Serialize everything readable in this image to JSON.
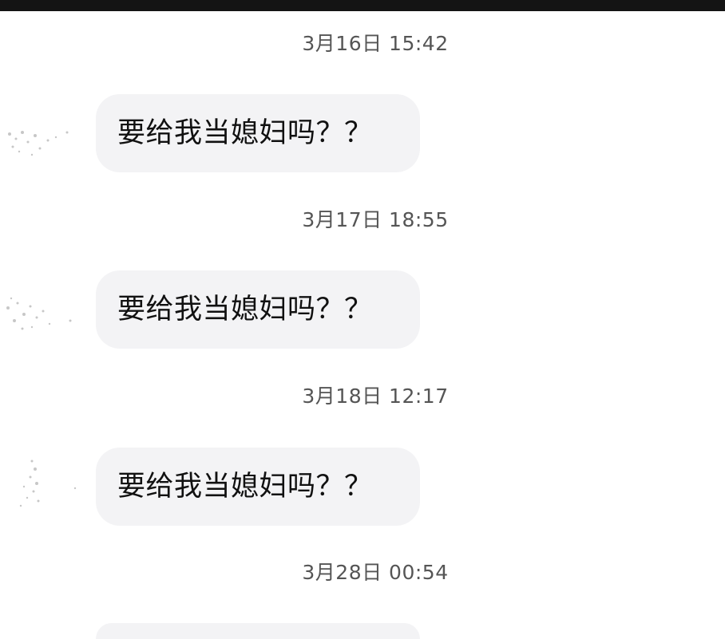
{
  "messages": [
    {
      "timestamp": "3月16日 15:42",
      "text": "要给我当媳妇吗？？"
    },
    {
      "timestamp": "3月17日 18:55",
      "text": "要给我当媳妇吗？？"
    },
    {
      "timestamp": "3月18日 12:17",
      "text": "要给我当媳妇吗？？"
    },
    {
      "timestamp": "3月28日 00:54",
      "text": ""
    }
  ],
  "colors": {
    "bubble_background": "#f3f3f5",
    "timestamp_text": "#555555",
    "message_text": "#111111",
    "status_bar": "#141414"
  },
  "icons": {
    "avatar": "blurred-avatar-icon"
  }
}
